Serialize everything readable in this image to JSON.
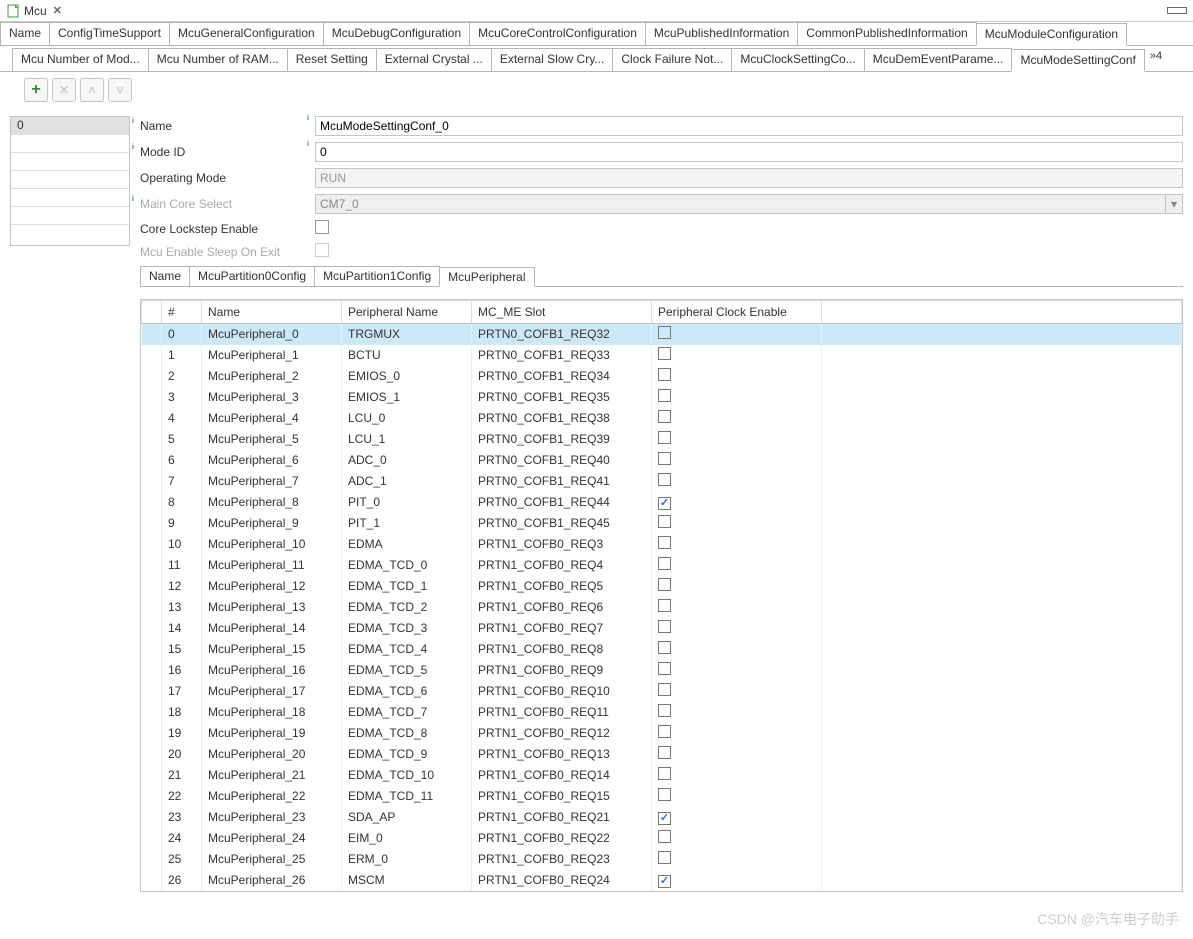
{
  "title": "Mcu",
  "topTabs": [
    "Name",
    "ConfigTimeSupport",
    "McuGeneralConfiguration",
    "McuDebugConfiguration",
    "McuCoreControlConfiguration",
    "McuPublishedInformation",
    "CommonPublishedInformation",
    "McuModuleConfiguration"
  ],
  "topTabActive": 7,
  "subTabs": [
    "Mcu Number of Mod...",
    "Mcu Number of RAM...",
    "Reset Setting",
    "External Crystal ...",
    "External Slow Cry...",
    "Clock Failure Not...",
    "McuClockSettingCo...",
    "McuDemEventParame...",
    "McuModeSettingConf"
  ],
  "subTabActive": 8,
  "subTabMore": "»4",
  "leftList": [
    "0"
  ],
  "form": {
    "nameLabel": "Name",
    "nameVal": "McuModeSettingConf_0",
    "modeIdLabel": "Mode ID",
    "modeIdVal": "0",
    "opModeLabel": "Operating Mode",
    "opModeVal": "RUN",
    "mainCoreLabel": "Main Core Select",
    "mainCoreVal": "CM7_0",
    "lockstepLabel": "Core Lockstep Enable",
    "sleepLabel": "Mcu Enable Sleep On Exit"
  },
  "innerTabs": [
    "Name",
    "McuPartition0Config",
    "McuPartition1Config",
    "McuPeripheral"
  ],
  "innerTabActive": 3,
  "gridHeaders": {
    "idx": "",
    "num": "#",
    "name": "Name",
    "pname": "Peripheral Name",
    "slot": "MC_ME Slot",
    "pce": "Peripheral Clock Enable"
  },
  "gridRows": [
    {
      "num": "0",
      "name": "McuPeripheral_0",
      "pname": "TRGMUX",
      "slot": "PRTN0_COFB1_REQ32",
      "pce": false,
      "sel": true
    },
    {
      "num": "1",
      "name": "McuPeripheral_1",
      "pname": "BCTU",
      "slot": "PRTN0_COFB1_REQ33",
      "pce": false
    },
    {
      "num": "2",
      "name": "McuPeripheral_2",
      "pname": "EMIOS_0",
      "slot": "PRTN0_COFB1_REQ34",
      "pce": false
    },
    {
      "num": "3",
      "name": "McuPeripheral_3",
      "pname": "EMIOS_1",
      "slot": "PRTN0_COFB1_REQ35",
      "pce": false
    },
    {
      "num": "4",
      "name": "McuPeripheral_4",
      "pname": "LCU_0",
      "slot": "PRTN0_COFB1_REQ38",
      "pce": false
    },
    {
      "num": "5",
      "name": "McuPeripheral_5",
      "pname": "LCU_1",
      "slot": "PRTN0_COFB1_REQ39",
      "pce": false
    },
    {
      "num": "6",
      "name": "McuPeripheral_6",
      "pname": "ADC_0",
      "slot": "PRTN0_COFB1_REQ40",
      "pce": false
    },
    {
      "num": "7",
      "name": "McuPeripheral_7",
      "pname": "ADC_1",
      "slot": "PRTN0_COFB1_REQ41",
      "pce": false
    },
    {
      "num": "8",
      "name": "McuPeripheral_8",
      "pname": "PIT_0",
      "slot": "PRTN0_COFB1_REQ44",
      "pce": true
    },
    {
      "num": "9",
      "name": "McuPeripheral_9",
      "pname": "PIT_1",
      "slot": "PRTN0_COFB1_REQ45",
      "pce": false
    },
    {
      "num": "10",
      "name": "McuPeripheral_10",
      "pname": "EDMA",
      "slot": "PRTN1_COFB0_REQ3",
      "pce": false
    },
    {
      "num": "11",
      "name": "McuPeripheral_11",
      "pname": "EDMA_TCD_0",
      "slot": "PRTN1_COFB0_REQ4",
      "pce": false
    },
    {
      "num": "12",
      "name": "McuPeripheral_12",
      "pname": "EDMA_TCD_1",
      "slot": "PRTN1_COFB0_REQ5",
      "pce": false
    },
    {
      "num": "13",
      "name": "McuPeripheral_13",
      "pname": "EDMA_TCD_2",
      "slot": "PRTN1_COFB0_REQ6",
      "pce": false
    },
    {
      "num": "14",
      "name": "McuPeripheral_14",
      "pname": "EDMA_TCD_3",
      "slot": "PRTN1_COFB0_REQ7",
      "pce": false
    },
    {
      "num": "15",
      "name": "McuPeripheral_15",
      "pname": "EDMA_TCD_4",
      "slot": "PRTN1_COFB0_REQ8",
      "pce": false
    },
    {
      "num": "16",
      "name": "McuPeripheral_16",
      "pname": "EDMA_TCD_5",
      "slot": "PRTN1_COFB0_REQ9",
      "pce": false
    },
    {
      "num": "17",
      "name": "McuPeripheral_17",
      "pname": "EDMA_TCD_6",
      "slot": "PRTN1_COFB0_REQ10",
      "pce": false
    },
    {
      "num": "18",
      "name": "McuPeripheral_18",
      "pname": "EDMA_TCD_7",
      "slot": "PRTN1_COFB0_REQ11",
      "pce": false
    },
    {
      "num": "19",
      "name": "McuPeripheral_19",
      "pname": "EDMA_TCD_8",
      "slot": "PRTN1_COFB0_REQ12",
      "pce": false
    },
    {
      "num": "20",
      "name": "McuPeripheral_20",
      "pname": "EDMA_TCD_9",
      "slot": "PRTN1_COFB0_REQ13",
      "pce": false
    },
    {
      "num": "21",
      "name": "McuPeripheral_21",
      "pname": "EDMA_TCD_10",
      "slot": "PRTN1_COFB0_REQ14",
      "pce": false
    },
    {
      "num": "22",
      "name": "McuPeripheral_22",
      "pname": "EDMA_TCD_11",
      "slot": "PRTN1_COFB0_REQ15",
      "pce": false
    },
    {
      "num": "23",
      "name": "McuPeripheral_23",
      "pname": "SDA_AP",
      "slot": "PRTN1_COFB0_REQ21",
      "pce": true
    },
    {
      "num": "24",
      "name": "McuPeripheral_24",
      "pname": "EIM_0",
      "slot": "PRTN1_COFB0_REQ22",
      "pce": false
    },
    {
      "num": "25",
      "name": "McuPeripheral_25",
      "pname": "ERM_0",
      "slot": "PRTN1_COFB0_REQ23",
      "pce": false
    },
    {
      "num": "26",
      "name": "McuPeripheral_26",
      "pname": "MSCM",
      "slot": "PRTN1_COFB0_REQ24",
      "pce": true
    }
  ],
  "watermark": "CSDN @汽车电子助手"
}
